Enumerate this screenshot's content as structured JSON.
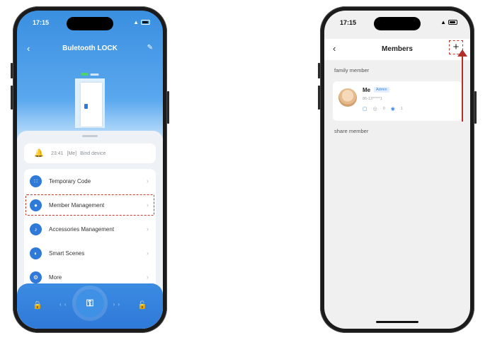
{
  "phone1": {
    "status_time": "17:15",
    "title": "Buletooth LOCK",
    "record": {
      "time": "23:41",
      "user": "[Me]",
      "action": "Bind device"
    },
    "menu": [
      {
        "label": "Temporary Code",
        "icon": "keypad-icon"
      },
      {
        "label": "Member Management",
        "icon": "person-icon"
      },
      {
        "label": "Accessories Management",
        "icon": "accessory-icon"
      },
      {
        "label": "Smart Scenes",
        "icon": "toggle-icon"
      },
      {
        "label": "More",
        "icon": "more-icon"
      }
    ],
    "highlighted_item": "Member Management"
  },
  "phone2": {
    "status_time": "17:15",
    "title": "Members",
    "family_label": "family member",
    "share_label": "share member",
    "member": {
      "name": "Me",
      "badge": "Admin",
      "sub": "86-13*****1",
      "count1": "0",
      "count2": "1"
    }
  },
  "colors": {
    "accent": "#2f7ad8",
    "highlight": "#c0392b"
  }
}
